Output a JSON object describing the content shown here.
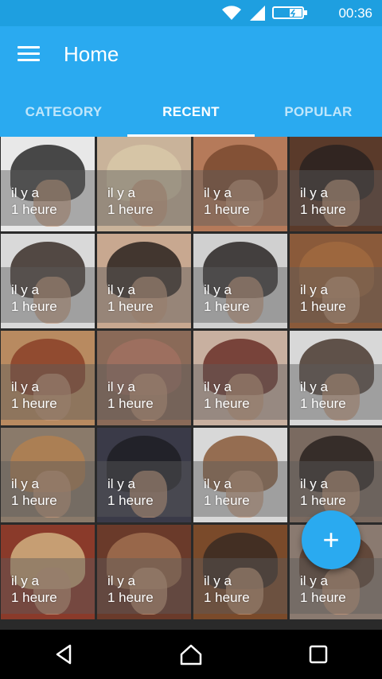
{
  "status": {
    "time": "00:36"
  },
  "app": {
    "title": "Home"
  },
  "tabs": [
    {
      "label": "CATEGORY",
      "active": false
    },
    {
      "label": "RECENT",
      "active": true
    },
    {
      "label": "POPULAR",
      "active": false
    }
  ],
  "tile_caption": {
    "line1": "il y a",
    "line2": "1 heure"
  },
  "tiles": [
    {
      "bg": "#e8e8e8",
      "hair": "#2a2a2a"
    },
    {
      "bg": "#c9b39a",
      "hair": "#d8c8a8"
    },
    {
      "bg": "#b57a5a",
      "hair": "#7a4a30"
    },
    {
      "bg": "#5a3a2a",
      "hair": "#2a2220"
    },
    {
      "bg": "#d9d9d9",
      "hair": "#3a2e28"
    },
    {
      "bg": "#c8a890",
      "hair": "#2a221e"
    },
    {
      "bg": "#d0d0d0",
      "hair": "#2a2624"
    },
    {
      "bg": "#8a5a3a",
      "hair": "#a06a40"
    },
    {
      "bg": "#b88a60",
      "hair": "#8a4028"
    },
    {
      "bg": "#8a6a58",
      "hair": "#a07060"
    },
    {
      "bg": "#c8b0a0",
      "hair": "#6a3028"
    },
    {
      "bg": "#d8d8d8",
      "hair": "#4a3a30"
    },
    {
      "bg": "#8a7a6a",
      "hair": "#b08050"
    },
    {
      "bg": "#3a3a48",
      "hair": "#1e1e24"
    },
    {
      "bg": "#d8d8d8",
      "hair": "#8a5a3a"
    },
    {
      "bg": "#7a6a60",
      "hair": "#2a2220"
    },
    {
      "bg": "#8a3a2a",
      "hair": "#d0b080"
    },
    {
      "bg": "#6a3a2a",
      "hair": "#a07050"
    },
    {
      "bg": "#7a4a2a",
      "hair": "#3a2a22"
    },
    {
      "bg": "#8a7a70",
      "hair": "#5a4030"
    }
  ],
  "fab": {
    "label": "+"
  }
}
